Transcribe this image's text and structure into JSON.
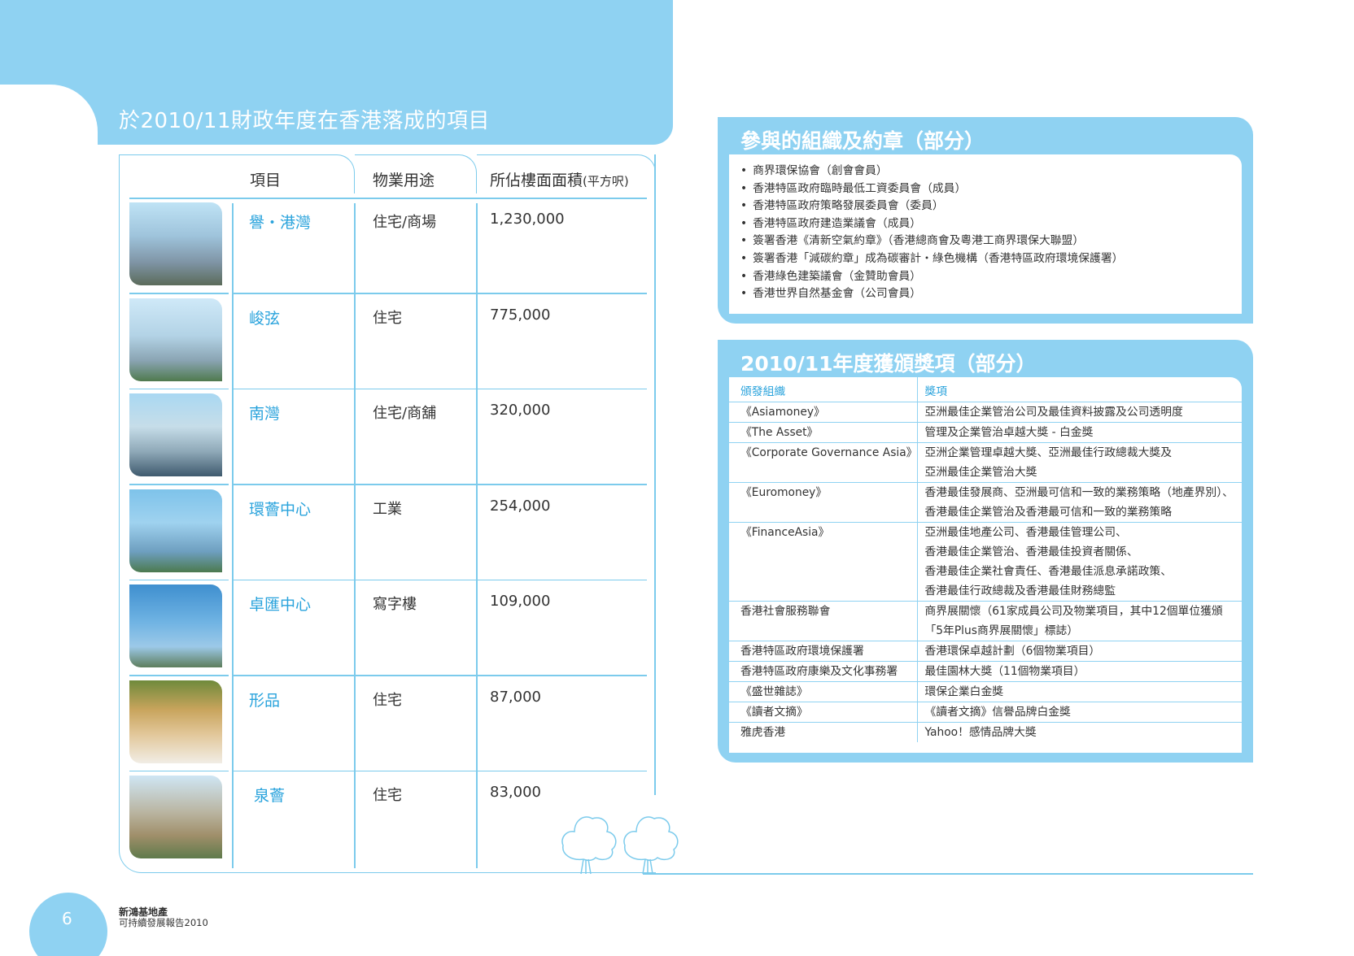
{
  "banner": {
    "title": "於2010/11財政年度在香港落成的項目"
  },
  "projects_table": {
    "headers": {
      "project": "項目",
      "usage": "物業用途",
      "gfa": "所佔樓面面積",
      "gfa_unit": "(平方呎)"
    },
    "rows": [
      {
        "name": "譽・港灣",
        "usage": "住宅/商場",
        "gfa": "1,230,000",
        "photo": "tower-cluster-photo"
      },
      {
        "name": "峻弦",
        "usage": "住宅",
        "gfa": "775,000",
        "photo": "residential-towers-photo"
      },
      {
        "name": "南灣",
        "usage": "住宅/商舖",
        "gfa": "320,000",
        "photo": "bay-towers-photo"
      },
      {
        "name": "環薈中心",
        "usage": "工業",
        "gfa": "254,000",
        "photo": "glass-tower-photo"
      },
      {
        "name": "卓匯中心",
        "usage": "寫字樓",
        "gfa": "109,000",
        "photo": "office-tower-photo"
      },
      {
        "name": "形品",
        "usage": "住宅",
        "gfa": "87,000",
        "photo": "interior-lounge-photo"
      },
      {
        "name": "泉薈",
        "usage": "住宅",
        "gfa": "83,000",
        "photo": "apartment-block-photo"
      }
    ]
  },
  "organisations": {
    "title": "參與的組織及約章（部分）",
    "items": [
      "商界環保協會（創會會員）",
      "香港特區政府臨時最低工資委員會（成員）",
      "香港特區政府策略發展委員會（委員）",
      "香港特區政府建造業議會（成員）",
      "簽署香港《清新空氣約章》（香港總商會及粵港工商界環保大聯盟）",
      "簽署香港「減碳約章」成為碳審計・綠色機構（香港特區政府環境保護署）",
      "香港綠色建築議會（金贊助會員）",
      "香港世界自然基金會（公司會員）"
    ]
  },
  "awards": {
    "title": "2010/11年度獲頒獎項（部分）",
    "col_org": "頒發組織",
    "col_award": "獎項",
    "rows": [
      {
        "org": "《Asiamoney》",
        "award": [
          "亞洲最佳企業管治公司及最佳資料披露及公司透明度"
        ]
      },
      {
        "org": "《The Asset》",
        "award": [
          "管理及企業管治卓越大獎 - 白金獎"
        ]
      },
      {
        "org": "《Corporate Governance Asia》",
        "award": [
          "亞洲企業管理卓越大獎、亞洲最佳行政總裁大獎及",
          "亞洲最佳企業管治大獎"
        ]
      },
      {
        "org": "《Euromoney》",
        "award": [
          "香港最佳發展商、亞洲最可信和一致的業務策略（地產界別）、",
          "香港最佳企業管治及香港最可信和一致的業務策略"
        ]
      },
      {
        "org": "《FinanceAsia》",
        "award": [
          "亞洲最佳地產公司、香港最佳管理公司、",
          "香港最佳企業管治、香港最佳投資者關係、",
          "香港最佳企業社會責任、香港最佳派息承諾政策、",
          "香港最佳行政總裁及香港最佳財務總監"
        ]
      },
      {
        "org": "香港社會服務聯會",
        "award": [
          "商界展關懷（61家成員公司及物業項目，其中12個單位獲頒",
          "「5年Plus商界展關懷」標誌）"
        ]
      },
      {
        "org": "香港特區政府環境保護署",
        "award": [
          "香港環保卓越計劃（6個物業項目）"
        ]
      },
      {
        "org": "香港特區政府康樂及文化事務署",
        "award": [
          "最佳園林大獎（11個物業項目）"
        ]
      },
      {
        "org": "《盛世雜誌》",
        "award": [
          "環保企業白金獎"
        ]
      },
      {
        "org": "《讀者文摘》",
        "award": [
          "《讀者文摘》信譽品牌白金獎"
        ]
      },
      {
        "org": "雅虎香港",
        "award": [
          "Yahoo！感情品牌大獎"
        ]
      }
    ]
  },
  "footer": {
    "page_number": "6",
    "company": "新鴻基地產",
    "report": "可持續發展報告2010"
  },
  "colors": {
    "brand_light_blue": "#8fd2f2",
    "accent_blue": "#2aa3dc",
    "line_blue": "#7ccbec"
  }
}
